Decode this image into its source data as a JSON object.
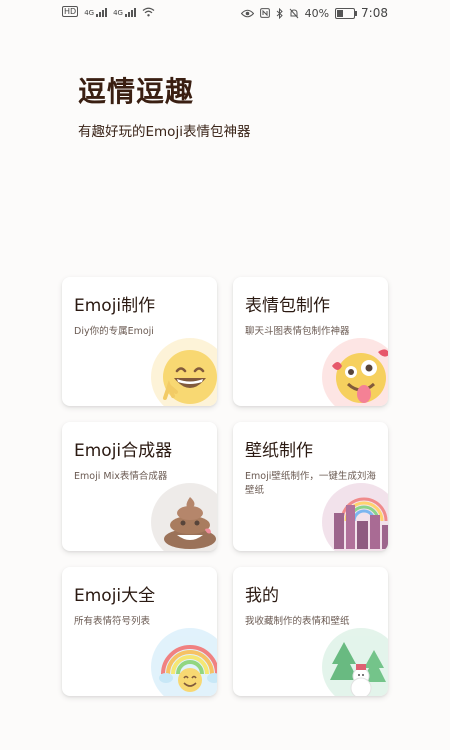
{
  "status_bar": {
    "left_badges": [
      "HD",
      "4G",
      "4G"
    ],
    "battery": "40%",
    "battery_level": 0.4,
    "time": "7:08"
  },
  "header": {
    "title": "逗情逗趣",
    "subtitle": "有趣好玩的Emoji表情包神器"
  },
  "cards": [
    {
      "title": "Emoji制作",
      "desc": "Diy你的专属Emoji",
      "icon": "grinning-face-icon",
      "bg": "#fdf1d2"
    },
    {
      "title": "表情包制作",
      "desc": "聊天斗图表情包制作神器",
      "icon": "zany-face-icon",
      "bg": "#fde1e0"
    },
    {
      "title": "Emoji合成器",
      "desc": "Emoji Mix表情合成器",
      "icon": "poop-icon",
      "bg": "#ece8e6"
    },
    {
      "title": "壁纸制作",
      "desc": "Emoji壁纸制作，一键生成刘海壁纸",
      "icon": "city-icon",
      "bg": "#f0dde8"
    },
    {
      "title": "Emoji大全",
      "desc": "所有表情符号列表",
      "icon": "rainbow-face-icon",
      "bg": "#dcf0fb"
    },
    {
      "title": "我的",
      "desc": "我收藏制作的表情和壁纸",
      "icon": "snowman-trees-icon",
      "bg": "#dff2e8"
    }
  ]
}
